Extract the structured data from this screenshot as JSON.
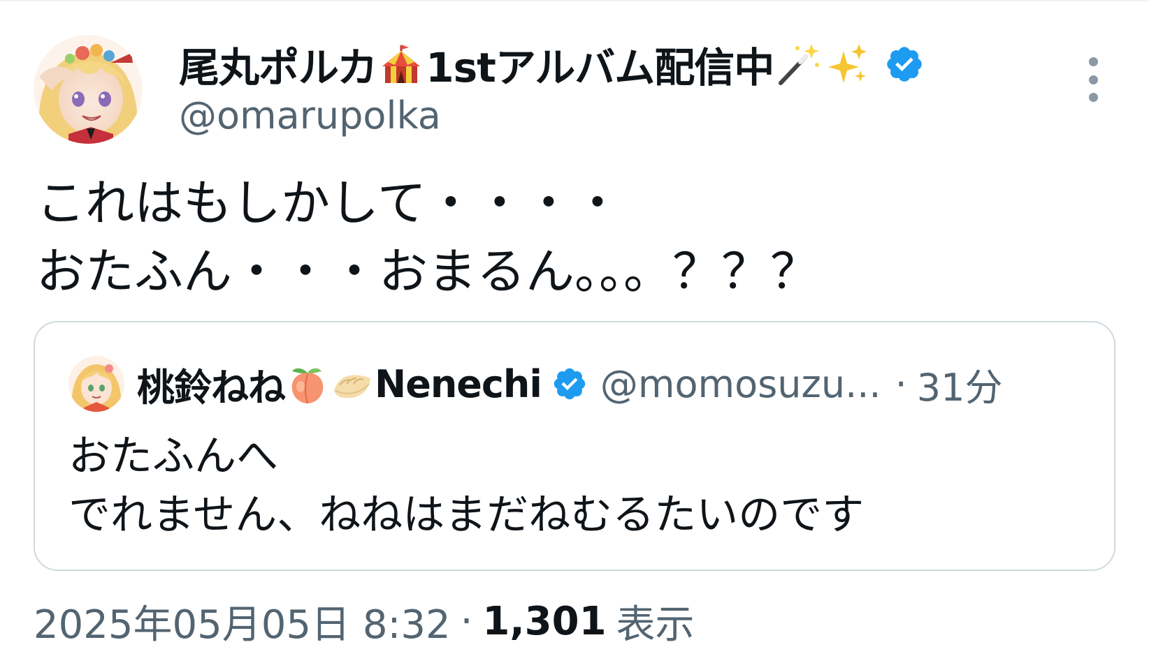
{
  "author": {
    "name_prefix": "尾丸ポルカ",
    "name_suffix": "1stアルバム配信中",
    "name_emojis": [
      "circus-tent-icon",
      "magic-wand-icon",
      "sparkles-icon"
    ],
    "handle": "@omarupolka",
    "verified": true
  },
  "tweet": {
    "lines": [
      "これはもしかして・・・・",
      "おたふん・・・おまるん。。。？？？"
    ]
  },
  "quote": {
    "name_prefix": "桃鈴ねね",
    "name_suffix": "Nenechi",
    "name_emojis": [
      "peach-icon",
      "dumpling-icon"
    ],
    "handle": "@momosuzu...",
    "separator": "·",
    "time": "31分",
    "lines": [
      "おたふんへ",
      "でれません、ねねはまだねむるたいのです"
    ]
  },
  "meta": {
    "date": "2025年05月05日 8:32",
    "separator": "·",
    "views_count": "1,301",
    "views_label": "表示"
  },
  "colors": {
    "text_primary": "#0f1419",
    "text_secondary": "#536471",
    "verified_blue": "#1d9bf0",
    "border": "#cfd9de"
  }
}
